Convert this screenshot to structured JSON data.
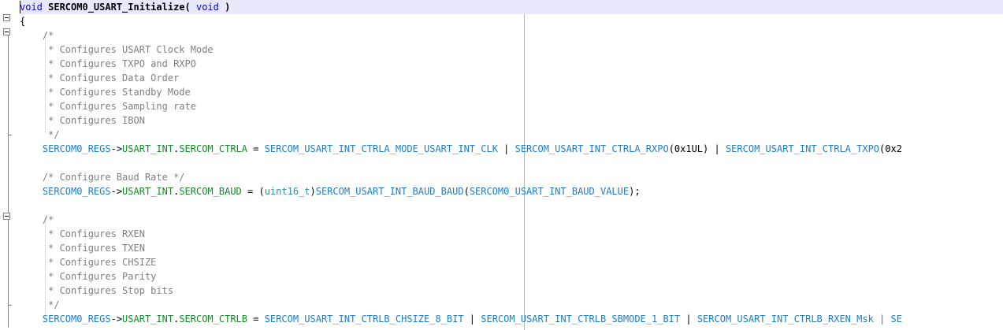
{
  "editor": {
    "lines": [
      [
        {
          "t": "void",
          "c": "kw"
        },
        {
          "t": " SERCOM0_USART_Initialize( ",
          "c": "fn"
        },
        {
          "t": "void",
          "c": "kw"
        },
        {
          "t": " )",
          "c": "fn"
        }
      ],
      [
        {
          "t": "{",
          "c": "pn"
        }
      ],
      [
        {
          "t": "    /*",
          "c": "cm"
        }
      ],
      [
        {
          "t": "     * Configures USART Clock Mode",
          "c": "cm"
        }
      ],
      [
        {
          "t": "     * Configures TXPO and RXPO",
          "c": "cm"
        }
      ],
      [
        {
          "t": "     * Configures Data Order",
          "c": "cm"
        }
      ],
      [
        {
          "t": "     * Configures Standby Mode",
          "c": "cm"
        }
      ],
      [
        {
          "t": "     * Configures Sampling rate",
          "c": "cm"
        }
      ],
      [
        {
          "t": "     * Configures IBON",
          "c": "cm"
        }
      ],
      [
        {
          "t": "     */",
          "c": "cm"
        }
      ],
      [
        {
          "t": "    SERCOM0_REGS",
          "c": "id"
        },
        {
          "t": "->",
          "c": "ar"
        },
        {
          "t": "USART_INT",
          "c": "mb"
        },
        {
          "t": ".",
          "c": "pn"
        },
        {
          "t": "SERCOM_CTRLA",
          "c": "mb"
        },
        {
          "t": " = ",
          "c": "pn"
        },
        {
          "t": "SERCOM_USART_INT_CTRLA_MODE_USART_INT_CLK",
          "c": "id"
        },
        {
          "t": " | ",
          "c": "pn"
        },
        {
          "t": "SERCOM_USART_INT_CTRLA_RXPO",
          "c": "id"
        },
        {
          "t": "(0x1UL)",
          "c": "num"
        },
        {
          "t": " | ",
          "c": "pn"
        },
        {
          "t": "SERCOM_USART_INT_CTRLA_TXPO",
          "c": "id"
        },
        {
          "t": "(0x2",
          "c": "num"
        }
      ],
      [
        {
          "t": "",
          "c": "pn"
        }
      ],
      [
        {
          "t": "    /* Configure Baud Rate */",
          "c": "cm"
        }
      ],
      [
        {
          "t": "    SERCOM0_REGS",
          "c": "id"
        },
        {
          "t": "->",
          "c": "ar"
        },
        {
          "t": "USART_INT",
          "c": "mb"
        },
        {
          "t": ".",
          "c": "pn"
        },
        {
          "t": "SERCOM_BAUD",
          "c": "mb"
        },
        {
          "t": " = (",
          "c": "pn"
        },
        {
          "t": "uint16_t",
          "c": "ty"
        },
        {
          "t": ")",
          "c": "pn"
        },
        {
          "t": "SERCOM_USART_INT_BAUD_BAUD",
          "c": "id"
        },
        {
          "t": "(",
          "c": "pn"
        },
        {
          "t": "SERCOM0_USART_INT_BAUD_VALUE",
          "c": "id"
        },
        {
          "t": ");",
          "c": "pn"
        }
      ],
      [
        {
          "t": "",
          "c": "pn"
        }
      ],
      [
        {
          "t": "    /*",
          "c": "cm"
        }
      ],
      [
        {
          "t": "     * Configures RXEN",
          "c": "cm"
        }
      ],
      [
        {
          "t": "     * Configures TXEN",
          "c": "cm"
        }
      ],
      [
        {
          "t": "     * Configures CHSIZE",
          "c": "cm"
        }
      ],
      [
        {
          "t": "     * Configures Parity",
          "c": "cm"
        }
      ],
      [
        {
          "t": "     * Configures Stop bits",
          "c": "cm"
        }
      ],
      [
        {
          "t": "     */",
          "c": "cm"
        }
      ],
      [
        {
          "t": "    SERCOM0_REGS",
          "c": "id"
        },
        {
          "t": "->",
          "c": "ar"
        },
        {
          "t": "USART_INT",
          "c": "mb"
        },
        {
          "t": ".",
          "c": "pn"
        },
        {
          "t": "SERCOM_CTRLB",
          "c": "mb"
        },
        {
          "t": " = ",
          "c": "pn"
        },
        {
          "t": "SERCOM_USART_INT_CTRLB_CHSIZE_8_BIT",
          "c": "id"
        },
        {
          "t": " | ",
          "c": "pn"
        },
        {
          "t": "SERCOM_USART_INT_CTRLB_SBMODE_1_BIT",
          "c": "id"
        },
        {
          "t": " | ",
          "c": "pn"
        },
        {
          "t": "SERCOM_USART_INT_CTRLB_RXEN_Msk",
          "c": "id"
        },
        {
          "t": " | SE",
          "c": "id"
        }
      ]
    ]
  }
}
